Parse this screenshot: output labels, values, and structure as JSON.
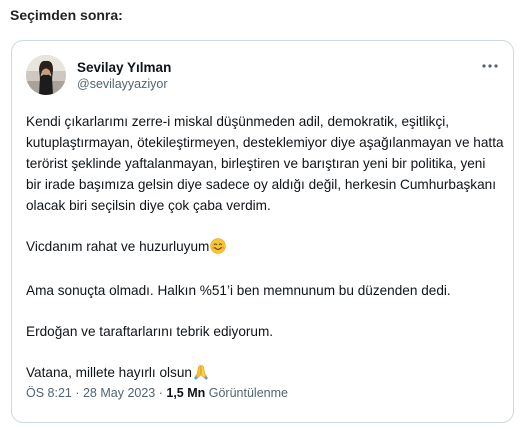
{
  "heading": "Seçimden sonra:",
  "author": {
    "name": "Sevilay Yılman",
    "handle": "@sevilayyaziyor"
  },
  "tweet": {
    "paragraph1": "Kendi çıkarlarımı zerre-i miskal düşünmeden adil, demokratik, eşitlikçi, kutuplaştırmayan, ötekileştirmeyen, desteklemiyor diye aşağılanmayan ve hatta terörist şeklinde yaftalanmayan, birleştiren ve barıştıran yeni bir politika, yeni bir irade başımıza gelsin diye sadece oy aldığı değil, herkesin Cumhurbaşkanı olacak biri seçilsin diye çok çaba verdim.",
    "paragraph2": "Vicdanım rahat ve huzurluyum",
    "paragraph3": "Ama sonuçta olmadı. Halkın %51’i ben memnunum bu düzenden dedi.",
    "paragraph4": "Erdoğan ve taraftarlarını tebrik ediyorum.",
    "paragraph5": "Vatana, millete hayırlı olsun"
  },
  "meta": {
    "time": "ÖS 8:21",
    "separator1": " · ",
    "date": "28 May 2023",
    "separator2": " · ",
    "views_count": "1,5 Mn",
    "views_label": " Görüntülenme"
  },
  "icons": {
    "avatar": "profile-photo",
    "more": "more-horizontal-icon",
    "emoji_smile": "smiling-face-emoji",
    "emoji_pray": "folded-hands-emoji"
  },
  "colors": {
    "text": "#0f1419",
    "secondary": "#536471",
    "border": "#cfd9de"
  }
}
